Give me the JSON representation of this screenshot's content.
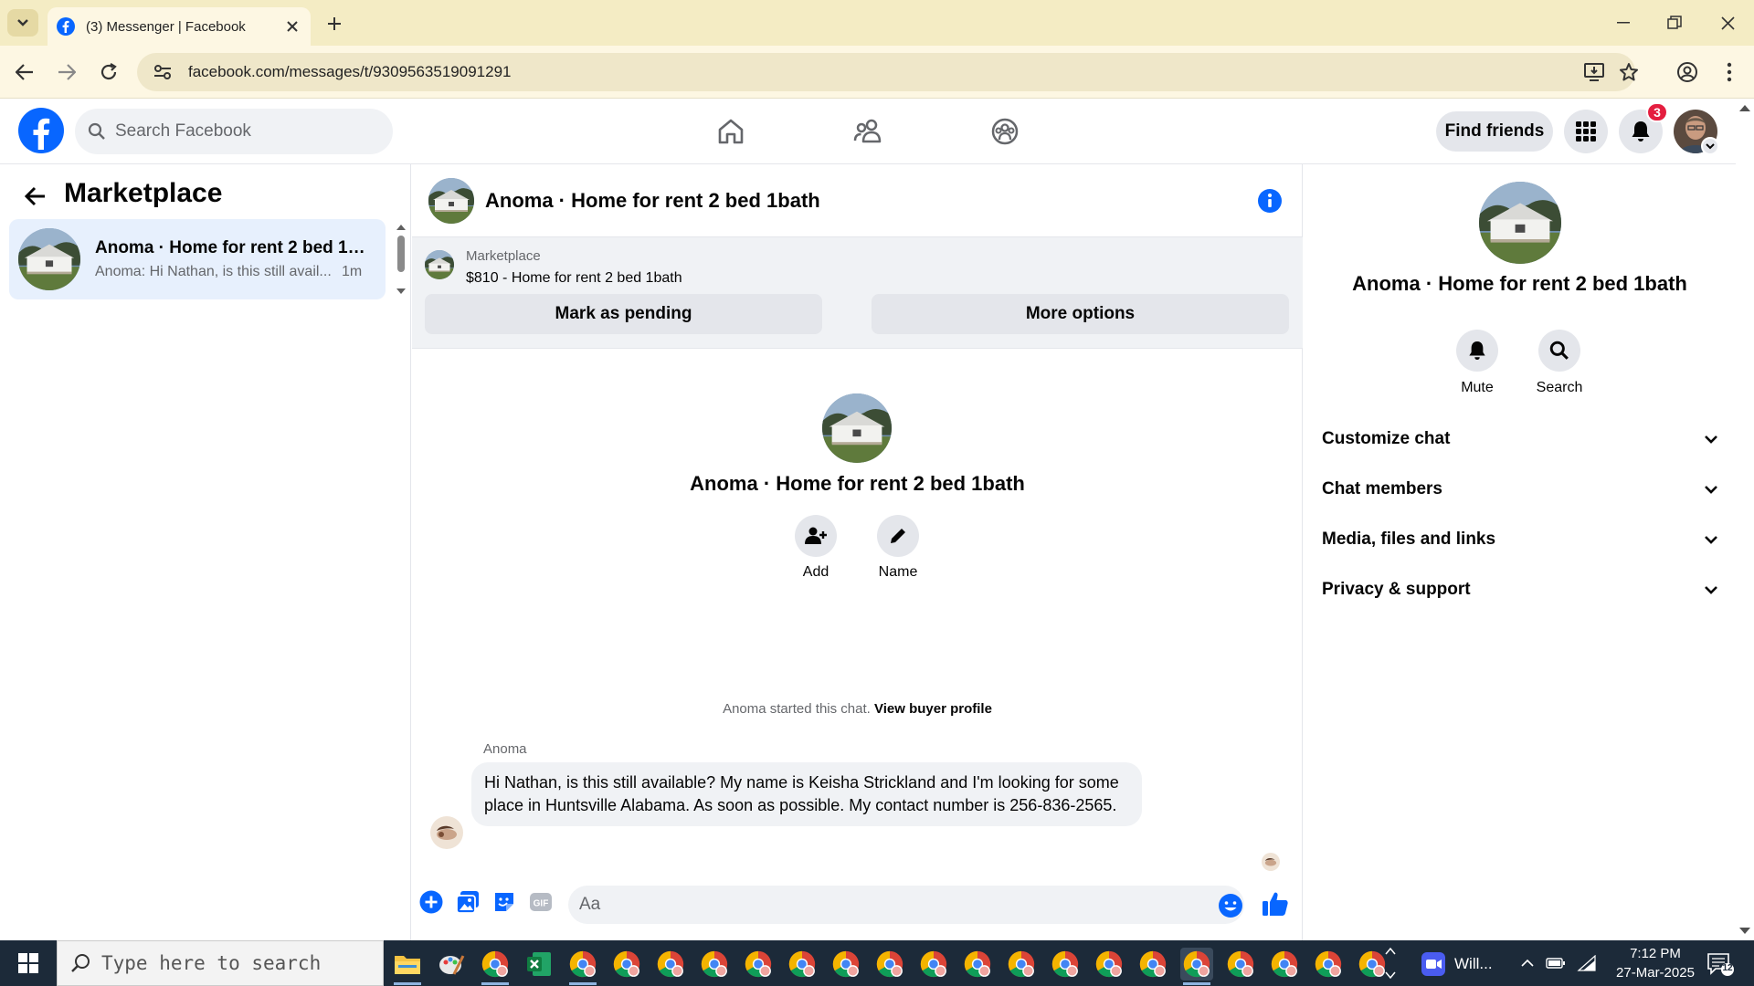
{
  "browser": {
    "tab_title": "(3) Messenger | Facebook",
    "url": "facebook.com/messages/t/9309563519091291"
  },
  "header": {
    "search_placeholder": "Search Facebook",
    "find_friends_label": "Find friends",
    "notification_count": "3"
  },
  "left": {
    "title": "Marketplace",
    "conversation": {
      "title": "Anoma · Home for rent 2 bed 1b...",
      "preview": "Anoma: Hi Nathan, is this still avail...",
      "time": "1m"
    }
  },
  "chat": {
    "title": "Anoma · Home for rent 2 bed 1bath",
    "marketplace_label": "Marketplace",
    "listing": "$810 - Home for rent 2 bed 1bath",
    "mark_pending_label": "Mark as pending",
    "more_options_label": "More options",
    "intro_name": "Anoma · Home for rent 2 bed 1bath",
    "add_label": "Add",
    "name_label": "Name",
    "started_text": "Anoma started this chat. ",
    "view_buyer_label": "View buyer profile",
    "sender": "Anoma",
    "message": "Hi Nathan, is this still available? My name is Keisha Strickland and I'm looking for some place in Huntsville Alabama. As soon as possible. My contact number is 256-836-2565.",
    "composer_placeholder": "Aa"
  },
  "right": {
    "name": "Anoma · Home for rent 2 bed 1bath",
    "mute_label": "Mute",
    "search_label": "Search",
    "rows": [
      "Customize chat",
      "Chat members",
      "Media, files and links",
      "Privacy & support"
    ]
  },
  "taskbar": {
    "search_placeholder": "Type here to search",
    "zoom_label": "Will...",
    "time": "7:12 PM",
    "date": "27-Mar-2025",
    "notif_count": "12"
  },
  "colors": {
    "fb_blue": "#0866ff",
    "chrome_tab_bg": "#f4ecc4",
    "taskbar_bg": "#1c2a39",
    "badge_red": "#e41e3f"
  }
}
